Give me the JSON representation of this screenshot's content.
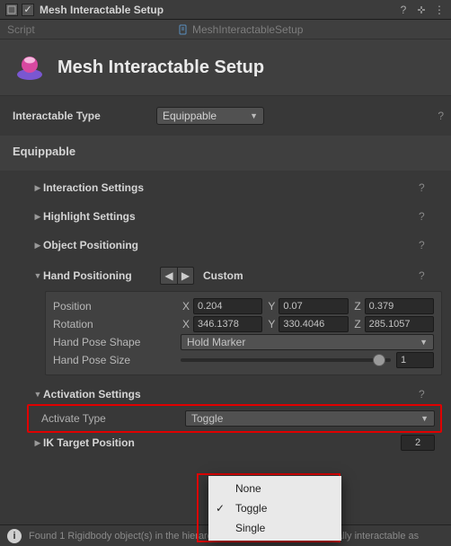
{
  "header": {
    "checkbox_checked": true,
    "title": "Mesh Interactable Setup"
  },
  "scriptRow": {
    "label": "Script",
    "value": "MeshInteractableSetup"
  },
  "titleCard": {
    "title": "Mesh Interactable Setup"
  },
  "interactableType": {
    "label": "Interactable Type",
    "value": "Equippable"
  },
  "sectionTitle": "Equippable",
  "foldouts": {
    "interaction": "Interaction Settings",
    "highlight": "Highlight Settings",
    "objectPos": "Object Positioning",
    "handPos": "Hand Positioning",
    "activation": "Activation Settings",
    "ikTarget": "IK Target Position"
  },
  "handPositioning": {
    "mode": "Custom",
    "position": {
      "label": "Position",
      "x": "0.204",
      "y": "0.07",
      "z": "0.379"
    },
    "rotation": {
      "label": "Rotation",
      "x": "346.1378",
      "y": "330.4046",
      "z": "285.1057"
    },
    "poseShape": {
      "label": "Hand Pose Shape",
      "value": "Hold Marker"
    },
    "poseSize": {
      "label": "Hand Pose Size",
      "value": "1"
    }
  },
  "activation": {
    "activateTypeLabel": "Activate Type",
    "activateTypeValue": "Toggle",
    "options": [
      "None",
      "Toggle",
      "Single"
    ],
    "selected": "Toggle"
  },
  "ikTarget": {
    "count": "2"
  },
  "axis": {
    "x": "X",
    "y": "Y",
    "z": "Z"
  },
  "footer": {
    "text": "Found 1 Rigidbody object(s) in the hierarchy below that will be individually interactable as"
  }
}
